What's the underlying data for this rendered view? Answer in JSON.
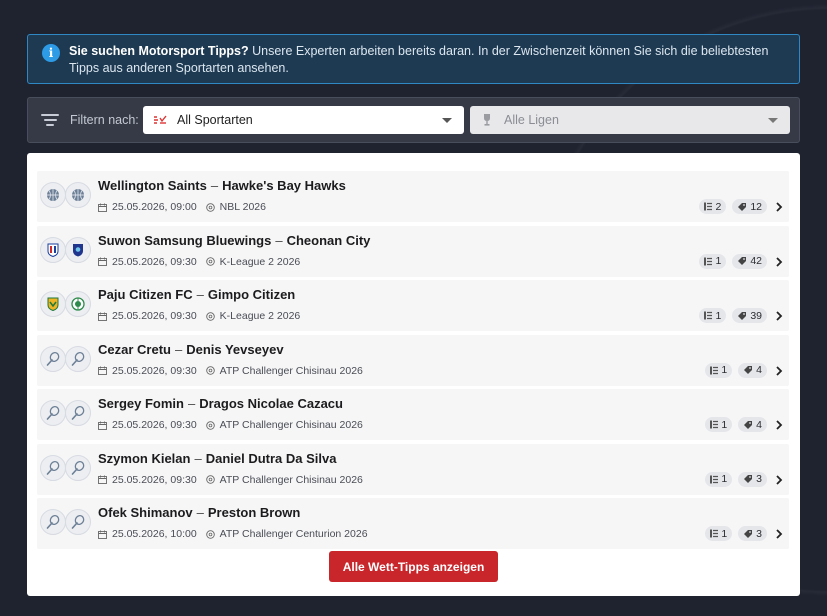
{
  "info": {
    "bold": "Sie suchen Motorsport Tipps?",
    "text": " Unsere Experten arbeiten bereits daran. In der Zwischenzeit können Sie sich die beliebtesten Tipps aus anderen Sportarten ansehen."
  },
  "filter": {
    "label": "Filtern nach:",
    "sport_value": "All Sportarten",
    "league_placeholder": "Alle Ligen"
  },
  "matches": [
    {
      "home": "Wellington Saints",
      "away": "Hawke's Bay Hawks",
      "date": "25.05.2026, 09:00",
      "league": "NBL 2026",
      "lines": "2",
      "tips": "12",
      "sport": "basketball"
    },
    {
      "home": "Suwon Samsung Bluewings",
      "away": "Cheonan City",
      "date": "25.05.2026, 09:30",
      "league": "K-League 2 2026",
      "lines": "1",
      "tips": "42",
      "sport": "football"
    },
    {
      "home": "Paju Citizen FC",
      "away": "Gimpo Citizen",
      "date": "25.05.2026, 09:30",
      "league": "K-League 2 2026",
      "lines": "1",
      "tips": "39",
      "sport": "football"
    },
    {
      "home": "Cezar Cretu",
      "away": "Denis Yevseyev",
      "date": "25.05.2026, 09:30",
      "league": "ATP Challenger Chisinau 2026",
      "lines": "1",
      "tips": "4",
      "sport": "tennis"
    },
    {
      "home": "Sergey Fomin",
      "away": "Dragos Nicolae Cazacu",
      "date": "25.05.2026, 09:30",
      "league": "ATP Challenger Chisinau 2026",
      "lines": "1",
      "tips": "4",
      "sport": "tennis"
    },
    {
      "home": "Szymon Kielan",
      "away": "Daniel Dutra Da Silva",
      "date": "25.05.2026, 09:30",
      "league": "ATP Challenger Chisinau 2026",
      "lines": "1",
      "tips": "3",
      "sport": "tennis"
    },
    {
      "home": "Ofek Shimanov",
      "away": "Preston Brown",
      "date": "25.05.2026, 10:00",
      "league": "ATP Challenger Centurion 2026",
      "lines": "1",
      "tips": "3",
      "sport": "tennis"
    }
  ],
  "cta_label": "Alle Wett-Tipps anzeigen",
  "colors": {
    "accent": "#c8262b",
    "info": "#2d9be6",
    "background": "#1f2330"
  }
}
